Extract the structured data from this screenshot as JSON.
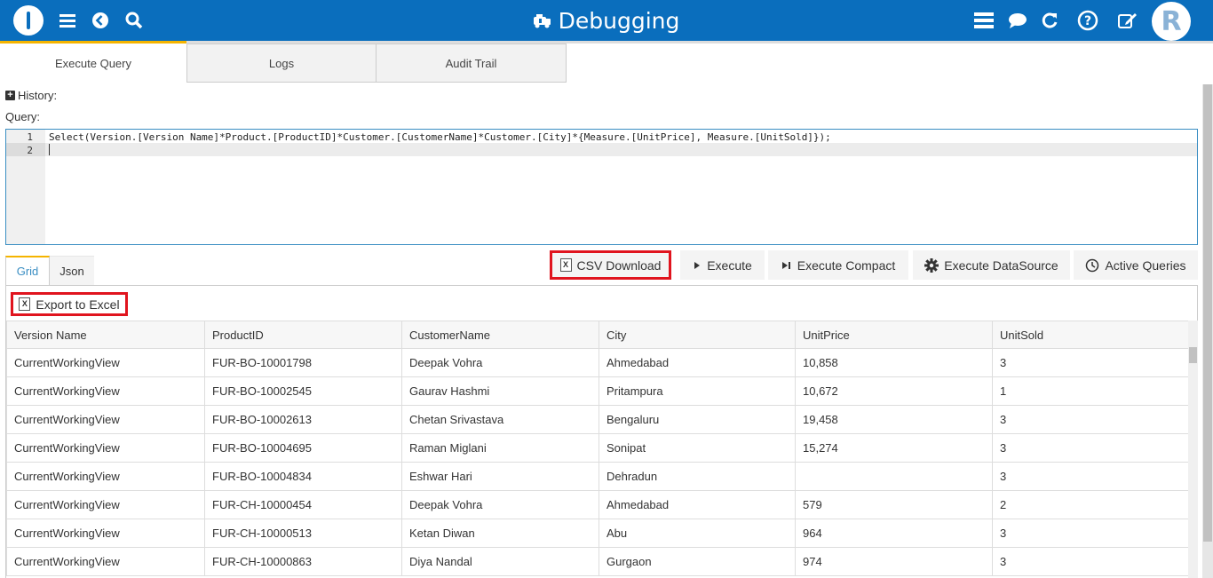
{
  "header": {
    "title": "Debugging",
    "avatar_letter": "R",
    "icons": [
      "app-logo",
      "menu-icon",
      "back-icon",
      "search-icon",
      "list-icon",
      "chat-icon",
      "refresh-icon",
      "help-icon",
      "edit-icon"
    ]
  },
  "tabs": [
    {
      "label": "Execute Query",
      "active": true
    },
    {
      "label": "Logs",
      "active": false
    },
    {
      "label": "Audit Trail",
      "active": false
    }
  ],
  "history_label": "History:",
  "query_label": "Query:",
  "editor": {
    "line_numbers": [
      "1",
      "2"
    ],
    "lines": [
      "Select(Version.[Version Name]*Product.[ProductID]*Customer.[CustomerName]*Customer.[City]*{Measure.[UnitPrice], Measure.[UnitSold]});",
      ""
    ]
  },
  "result_tabs": [
    {
      "label": "Grid",
      "active": true
    },
    {
      "label": "Json",
      "active": false
    }
  ],
  "toolbar": {
    "csv_download": "CSV Download",
    "execute": "Execute",
    "execute_compact": "Execute Compact",
    "execute_datasource": "Execute DataSource",
    "active_queries": "Active Queries"
  },
  "export_label": "Export to Excel",
  "grid": {
    "columns": [
      "Version Name",
      "ProductID",
      "CustomerName",
      "City",
      "UnitPrice",
      "UnitSold"
    ],
    "rows": [
      [
        "CurrentWorkingView",
        "FUR-BO-10001798",
        "Deepak Vohra",
        "Ahmedabad",
        "10,858",
        "3"
      ],
      [
        "CurrentWorkingView",
        "FUR-BO-10002545",
        "Gaurav Hashmi",
        "Pritampura",
        "10,672",
        "1"
      ],
      [
        "CurrentWorkingView",
        "FUR-BO-10002613",
        "Chetan Srivastava",
        "Bengaluru",
        "19,458",
        "3"
      ],
      [
        "CurrentWorkingView",
        "FUR-BO-10004695",
        "Raman Miglani",
        "Sonipat",
        "15,274",
        "3"
      ],
      [
        "CurrentWorkingView",
        "FUR-BO-10004834",
        "Eshwar Hari",
        "Dehradun",
        "",
        "3"
      ],
      [
        "CurrentWorkingView",
        "FUR-CH-10000454",
        "Deepak Vohra",
        "Ahmedabad",
        "579",
        "2"
      ],
      [
        "CurrentWorkingView",
        "FUR-CH-10000513",
        "Ketan Diwan",
        "Abu",
        "964",
        "3"
      ],
      [
        "CurrentWorkingView",
        "FUR-CH-10000863",
        "Diya Nandal",
        "Gurgaon",
        "974",
        "3"
      ]
    ]
  },
  "colors": {
    "header_bg": "#0a6ebd",
    "accent": "#f5b400",
    "highlight_box": "#e0141e"
  }
}
